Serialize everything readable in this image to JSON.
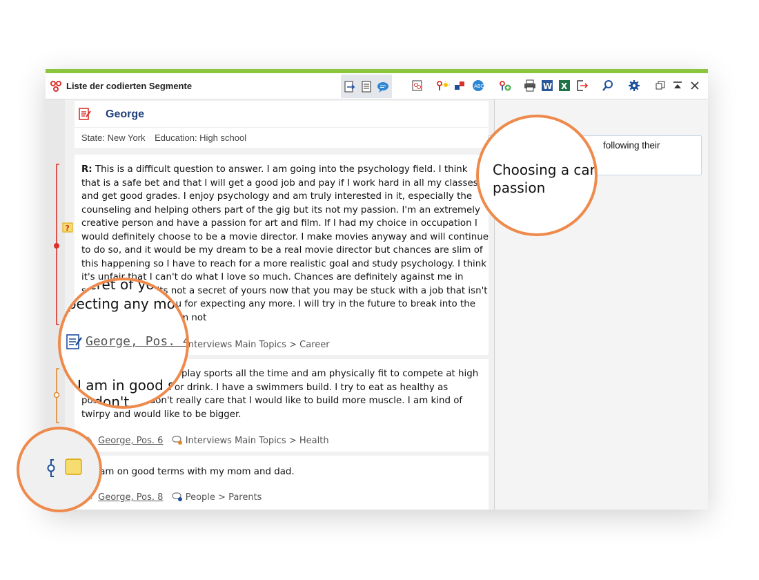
{
  "window": {
    "title": "Liste der codierten Segmente",
    "accent_color": "#8cc63f"
  },
  "toolbar": {
    "view_group": [
      "export-view-icon",
      "list-view-icon",
      "speech-bubble-icon"
    ],
    "tools": [
      "code-filter-icon",
      "activate-icon",
      "color-filter-icon",
      "spellcheck-icon",
      "add-code-icon",
      "print-icon",
      "word-export-icon",
      "excel-export-icon",
      "export-icon",
      "search-icon",
      "settings-icon"
    ],
    "window_controls": [
      "restore-icon",
      "collapse-up-icon",
      "close-icon"
    ]
  },
  "document": {
    "name": "George",
    "variables": [
      "State: New York",
      "Education: High school"
    ]
  },
  "segments": [
    {
      "text_label": "R:",
      "text": "This is a difficult question to answer. I am going into the psychology field. I think that is a safe bet and that I will get a good job and pay if I work hard in all my classes and get good grades. I enjoy psychology and am truly interested in it, especially the counseling and helping others part of the gig but its not my passion. I'm an extremely creative person and have a passion for art and film. If I had my choice in occupation I would definitely choose to be a movie director. I make movies anyway and will continue to do so, and it would be my dream to be a real movie director but chances are slim of this happening so I have to reach for a more realistic goal and study psychology. I think it's unfair that I can't do what I love so much. Chances are definitely against me in succeeding and its not a secret of yours now that you may be stuck with a job that isn't that rewarding to you for expecting any more. I will try in the future to break into the movie business but I'm not",
      "source": "George, Pos. 4",
      "code": "Interviews Main Topics > Career",
      "bracket_color": "#d9322b"
    },
    {
      "text": "I am in good shape. I play sports all the time and am physically fit to compete at high level. I don't smoke or drink. I have a swimmers build. I try to eat as healthy as possible. But I don't really care that I would like to build more muscle. I am kind of twirpy and would like to be bigger.",
      "source": "George, Pos. 6",
      "code": "Interviews Main Topics > Health",
      "bracket_color": "#e0872a"
    },
    {
      "text": "I am on good terms with my mom and dad.",
      "source": "George, Pos. 8",
      "code": "People > Parents",
      "bracket_color": "#1d4f9c"
    }
  ],
  "memo": {
    "text": "Choosing a career following their passion",
    "text_tail": "following their"
  },
  "zoom": {
    "memo_title_line1": "Choosing a care",
    "memo_title_line2": "passion",
    "seg1_line1": "secret of you",
    "seg1_line2": "xpecting any mo",
    "seg1_source": "George, Pos. 4",
    "seg2_line1": "I am in good sh",
    "seg2_line2": "I don't"
  },
  "colors": {
    "highlight_circle": "#ee8a4c",
    "doc_name": "#1f3f7a",
    "memo_yellow": "#f7dc6f"
  }
}
